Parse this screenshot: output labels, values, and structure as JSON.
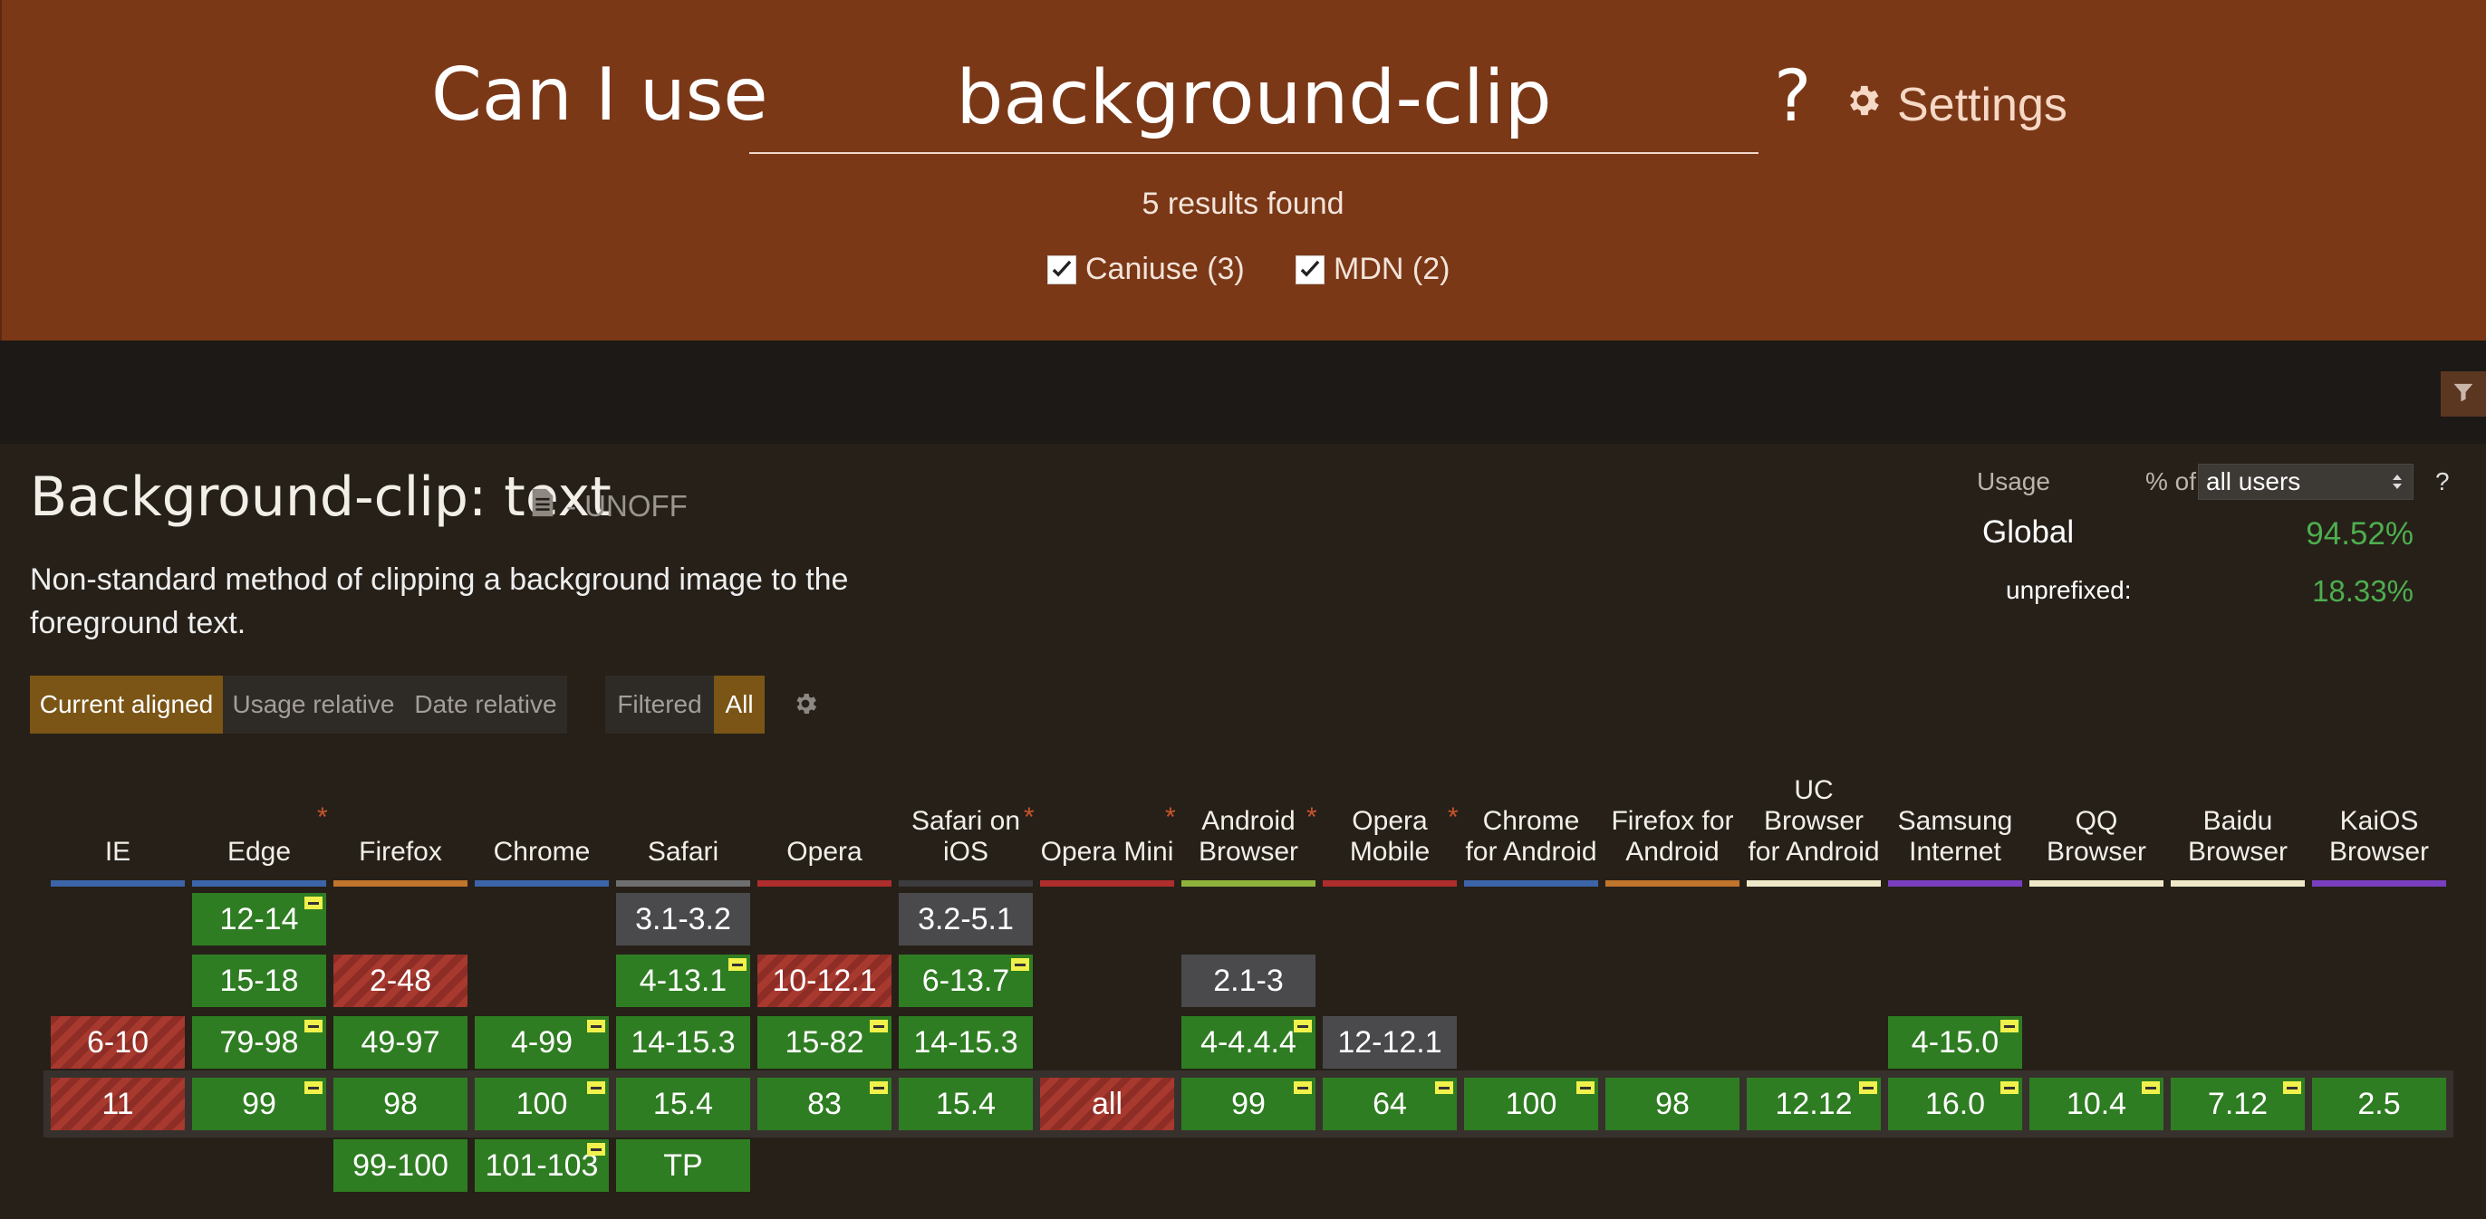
{
  "header": {
    "search_lead": "Can I use",
    "search_value": "background-clip",
    "search_question": "?",
    "settings_label": "Settings",
    "results_text": "5 results found",
    "filters": [
      {
        "label": "Caniuse (3)",
        "checked": true
      },
      {
        "label": "MDN (2)",
        "checked": true
      }
    ]
  },
  "feature": {
    "title": "Background-clip: text",
    "status": "- UNOFF",
    "description": "Non-standard method of clipping a background image to the foreground text."
  },
  "view_controls": {
    "current_aligned": "Current aligned",
    "usage_relative": "Usage relative",
    "date_relative": "Date relative",
    "filtered": "Filtered",
    "all": "All"
  },
  "usage": {
    "label": "Usage",
    "percent_of": "% of",
    "scope": "all users",
    "help": "?",
    "global_label": "Global",
    "global_value": "94.52%",
    "unprefixed_label": "unprefixed:",
    "unprefixed_value": "18.33%"
  },
  "colors": {
    "header_bg": "#7b3817",
    "supported": "#2f7d22",
    "unsupported": "#8e2d25",
    "unknown": "#4a4a4c",
    "note_flag": "#f1f14c",
    "usage_value": "#4eae4e"
  },
  "browsers": [
    {
      "name": "IE",
      "bar": "#3d64a8",
      "star": false
    },
    {
      "name": "Edge",
      "bar": "#3d64a8",
      "star": true
    },
    {
      "name": "Firefox",
      "bar": "#c0752d",
      "star": false
    },
    {
      "name": "Chrome",
      "bar": "#3d64a8",
      "star": false
    },
    {
      "name": "Safari",
      "bar": "#6f6f70",
      "star": false
    },
    {
      "name": "Opera",
      "bar": "#b02d2d",
      "star": false
    },
    {
      "name": "Safari on iOS",
      "bar": "#3c3c3e",
      "star": true
    },
    {
      "name": "Opera Mini",
      "bar": "#b02d2d",
      "star": true
    },
    {
      "name": "Android Browser",
      "bar": "#8fb33a",
      "star": true
    },
    {
      "name": "Opera Mobile",
      "bar": "#b02d2d",
      "star": true
    },
    {
      "name": "Chrome for Android",
      "bar": "#3d64a8",
      "star": false
    },
    {
      "name": "Firefox for Android",
      "bar": "#c0752d",
      "star": false
    },
    {
      "name": "UC Browser for Android",
      "bar": "#efe9c8",
      "star": false
    },
    {
      "name": "Samsung Internet",
      "bar": "#7a3fc0",
      "star": false
    },
    {
      "name": "QQ Browser",
      "bar": "#efe9c8",
      "star": false
    },
    {
      "name": "Baidu Browser",
      "bar": "#efe9c8",
      "star": false
    },
    {
      "name": "KaiOS Browser",
      "bar": "#7a3fc0",
      "star": false
    }
  ],
  "support_rows": [
    [
      null,
      {
        "v": "12-14",
        "s": "y",
        "n": true
      },
      null,
      null,
      {
        "v": "3.1-3.2",
        "s": "u"
      },
      null,
      {
        "v": "3.2-5.1",
        "s": "u"
      },
      null,
      null,
      null,
      null,
      null,
      null,
      null,
      null,
      null,
      null
    ],
    [
      null,
      {
        "v": "15-18",
        "s": "y"
      },
      {
        "v": "2-48",
        "s": "n"
      },
      null,
      {
        "v": "4-13.1",
        "s": "y",
        "n": true
      },
      {
        "v": "10-12.1",
        "s": "n"
      },
      {
        "v": "6-13.7",
        "s": "y",
        "n": true
      },
      null,
      {
        "v": "2.1-3",
        "s": "u"
      },
      null,
      null,
      null,
      null,
      null,
      null,
      null,
      null
    ],
    [
      {
        "v": "6-10",
        "s": "n"
      },
      {
        "v": "79-98",
        "s": "y",
        "n": true
      },
      {
        "v": "49-97",
        "s": "y"
      },
      {
        "v": "4-99",
        "s": "y",
        "n": true
      },
      {
        "v": "14-15.3",
        "s": "y"
      },
      {
        "v": "15-82",
        "s": "y",
        "n": true
      },
      {
        "v": "14-15.3",
        "s": "y"
      },
      null,
      {
        "v": "4-4.4.4",
        "s": "y",
        "n": true
      },
      {
        "v": "12-12.1",
        "s": "u"
      },
      null,
      null,
      null,
      {
        "v": "4-15.0",
        "s": "y",
        "n": true
      },
      null,
      null,
      null
    ],
    [
      {
        "v": "11",
        "s": "n"
      },
      {
        "v": "99",
        "s": "y",
        "n": true
      },
      {
        "v": "98",
        "s": "y"
      },
      {
        "v": "100",
        "s": "y",
        "n": true
      },
      {
        "v": "15.4",
        "s": "y"
      },
      {
        "v": "83",
        "s": "y",
        "n": true
      },
      {
        "v": "15.4",
        "s": "y"
      },
      {
        "v": "all",
        "s": "n"
      },
      {
        "v": "99",
        "s": "y",
        "n": true
      },
      {
        "v": "64",
        "s": "y",
        "n": true
      },
      {
        "v": "100",
        "s": "y",
        "n": true
      },
      {
        "v": "98",
        "s": "y"
      },
      {
        "v": "12.12",
        "s": "y",
        "n": true
      },
      {
        "v": "16.0",
        "s": "y",
        "n": true
      },
      {
        "v": "10.4",
        "s": "y",
        "n": true
      },
      {
        "v": "7.12",
        "s": "y",
        "n": true
      },
      {
        "v": "2.5",
        "s": "y"
      }
    ],
    [
      null,
      null,
      {
        "v": "99-100",
        "s": "y"
      },
      {
        "v": "101-103",
        "s": "y",
        "n": true
      },
      {
        "v": "TP",
        "s": "y"
      },
      null,
      null,
      null,
      null,
      null,
      null,
      null,
      null,
      null,
      null,
      null,
      null
    ]
  ]
}
